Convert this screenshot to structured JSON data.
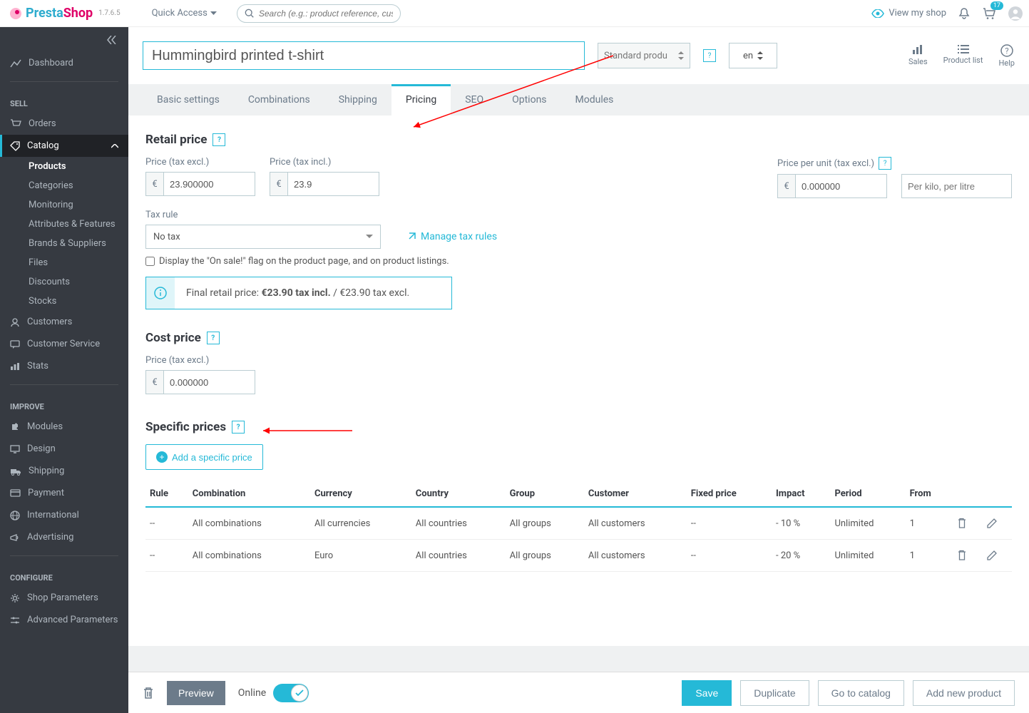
{
  "topbar": {
    "brand1": "Presta",
    "brand2": "Shop",
    "version": "1.7.6.5",
    "quick_access": "Quick Access",
    "search_placeholder": "Search (e.g.: product reference, custome",
    "view_shop": "View my shop",
    "bell_badge": "17"
  },
  "sidebar": {
    "dashboard": "Dashboard",
    "sell": "SELL",
    "orders": "Orders",
    "catalog": "Catalog",
    "catalog_sub": {
      "products": "Products",
      "categories": "Categories",
      "monitoring": "Monitoring",
      "attributes": "Attributes & Features",
      "brands": "Brands & Suppliers",
      "files": "Files",
      "discounts": "Discounts",
      "stocks": "Stocks"
    },
    "customers": "Customers",
    "customer_service": "Customer Service",
    "stats": "Stats",
    "improve": "IMPROVE",
    "modules": "Modules",
    "design": "Design",
    "shipping": "Shipping",
    "payment": "Payment",
    "international": "International",
    "advertising": "Advertising",
    "configure": "CONFIGURE",
    "shop_params": "Shop Parameters",
    "adv_params": "Advanced Parameters"
  },
  "header": {
    "product_name": "Hummingbird printed t-shirt",
    "std_select": "Standard produ",
    "lang": "en",
    "actions": {
      "sales": "Sales",
      "product_list": "Product list",
      "help": "Help"
    }
  },
  "tabs": {
    "basic": "Basic settings",
    "combinations": "Combinations",
    "shipping": "Shipping",
    "pricing": "Pricing",
    "seo": "SEO",
    "options": "Options",
    "modules": "Modules"
  },
  "pricing": {
    "retail_heading": "Retail price",
    "price_excl_label": "Price (tax excl.)",
    "price_incl_label": "Price (tax incl.)",
    "unit_price_label": "Price per unit (tax excl.)",
    "currency": "€",
    "price_excl": "23.900000",
    "price_incl": "23.9",
    "unit_price": "0.000000",
    "unit_placeholder": "Per kilo, per litre",
    "tax_rule_label": "Tax rule",
    "tax_rule_value": "No tax",
    "manage_tax": "Manage tax rules",
    "on_sale_label": "Display the \"On sale!\" flag on the product page, and on product listings.",
    "final_label": "Final retail price: ",
    "final_incl": "€23.90 tax incl.",
    "final_sep": " / ",
    "final_excl": "€23.90 tax excl.",
    "cost_heading": "Cost price",
    "cost_price": "0.000000",
    "specific_heading": "Specific prices",
    "add_specific": "Add a specific price",
    "table_headers": {
      "rule": "Rule",
      "combination": "Combination",
      "currency": "Currency",
      "country": "Country",
      "group": "Group",
      "customer": "Customer",
      "fixed": "Fixed price",
      "impact": "Impact",
      "period": "Period",
      "from": "From"
    },
    "rows": [
      {
        "rule": "--",
        "combination": "All combinations",
        "currency": "All currencies",
        "country": "All countries",
        "group": "All groups",
        "customer": "All customers",
        "fixed": "--",
        "impact": "- 10 %",
        "period": "Unlimited",
        "from": "1"
      },
      {
        "rule": "--",
        "combination": "All combinations",
        "currency": "Euro",
        "country": "All countries",
        "group": "All groups",
        "customer": "All customers",
        "fixed": "--",
        "impact": "- 20 %",
        "period": "Unlimited",
        "from": "1"
      }
    ]
  },
  "footer": {
    "preview": "Preview",
    "online": "Online",
    "save": "Save",
    "duplicate": "Duplicate",
    "catalog": "Go to catalog",
    "add_new": "Add new product"
  }
}
